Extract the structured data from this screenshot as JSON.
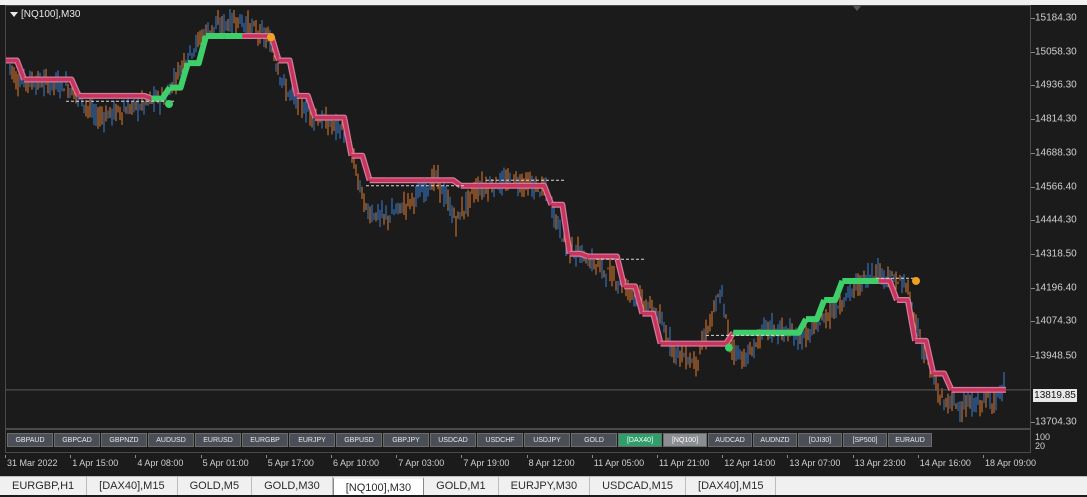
{
  "chart_title": "[NQ100],M30",
  "price_axis": {
    "ticks": [
      "15184.30",
      "15058.30",
      "14936.30",
      "14814.30",
      "14688.30",
      "14566.40",
      "14444.30",
      "14318.50",
      "14196.40",
      "14074.30",
      "13948.50",
      "13704.30"
    ],
    "values": [
      15184.3,
      15058.3,
      14936.3,
      14814.3,
      14688.3,
      14566.4,
      14444.3,
      14318.5,
      14196.4,
      14074.3,
      13948.5,
      13704.3
    ],
    "current_price": "13819.85"
  },
  "time_axis": [
    "31 Mar 2022",
    "1 Apr 15:00",
    "4 Apr 08:00",
    "5 Apr 01:00",
    "5 Apr 17:00",
    "6 Apr 10:00",
    "7 Apr 03:00",
    "7 Apr 19:00",
    "8 Apr 12:00",
    "11 Apr 05:00",
    "11 Apr 21:00",
    "12 Apr 14:00",
    "13 Apr 07:00",
    "13 Apr 23:00",
    "14 Apr 16:00",
    "18 Apr 09:00"
  ],
  "symbols": [
    {
      "label": "GBPAUD",
      "state": "normal"
    },
    {
      "label": "GBPCAD",
      "state": "normal"
    },
    {
      "label": "GBPNZD",
      "state": "normal"
    },
    {
      "label": "AUDUSD",
      "state": "normal"
    },
    {
      "label": "EURUSD",
      "state": "normal"
    },
    {
      "label": "EURGBP",
      "state": "normal"
    },
    {
      "label": "EURJPY",
      "state": "normal"
    },
    {
      "label": "GBPUSD",
      "state": "normal"
    },
    {
      "label": "GBPJPY",
      "state": "normal"
    },
    {
      "label": "USDCAD",
      "state": "normal"
    },
    {
      "label": "USDCHF",
      "state": "normal"
    },
    {
      "label": "USDJPY",
      "state": "normal"
    },
    {
      "label": "GOLD",
      "state": "normal"
    },
    {
      "label": "[DAX40]",
      "state": "active"
    },
    {
      "label": "[NQ100]",
      "state": "selected"
    },
    {
      "label": "AUDCAD",
      "state": "normal"
    },
    {
      "label": "AUDNZD",
      "state": "normal"
    },
    {
      "label": "[DJI30]",
      "state": "normal"
    },
    {
      "label": "[SP500]",
      "state": "normal"
    },
    {
      "label": "EURAUD",
      "state": "normal"
    }
  ],
  "sub_axis": {
    "top": "100",
    "bottom": "20"
  },
  "tabs": [
    {
      "label": "EURGBP,H1",
      "active": false
    },
    {
      "label": "[DAX40],M15",
      "active": false
    },
    {
      "label": "GOLD,M5",
      "active": false
    },
    {
      "label": "GOLD,M30",
      "active": false
    },
    {
      "label": "[NQ100],M30",
      "active": true
    },
    {
      "label": "GOLD,M1",
      "active": false
    },
    {
      "label": "EURJPY,M30",
      "active": false
    },
    {
      "label": "USDCAD,M15",
      "active": false
    },
    {
      "label": "[DAX40],M15",
      "active": false
    }
  ],
  "colors": {
    "bull_candle": "#3a7fd5",
    "bear_candle": "#e07b2e",
    "trend_down": "#c9345a",
    "trend_down_edge": "#d27aa0",
    "trend_up": "#3ecf6a",
    "signal_sell": "#f0a21e",
    "background": "#1b1b1b"
  },
  "chart_data": {
    "type": "line",
    "title": "[NQ100],M30",
    "series": [
      {
        "name": "",
        "values": [
          15030,
          14960,
          14960,
          14960,
          14900,
          14900,
          14900,
          14900,
          14890,
          14930,
          15020,
          15120,
          15120,
          15120,
          15120,
          15030,
          14900,
          14820,
          14820,
          14680,
          14590,
          14590,
          14590,
          14590,
          14590,
          14570,
          14570,
          14570,
          14570,
          14570,
          14500,
          14320,
          14310,
          14310,
          14200,
          14100,
          13990,
          13990,
          13990,
          13990,
          14030,
          14030,
          14030,
          14030,
          14080,
          14150,
          14220,
          14220,
          14220,
          14150,
          14000,
          13880,
          13820,
          13820,
          13820,
          13820
        ]
      }
    ],
    "y_range": [
      13680,
      15230
    ]
  }
}
